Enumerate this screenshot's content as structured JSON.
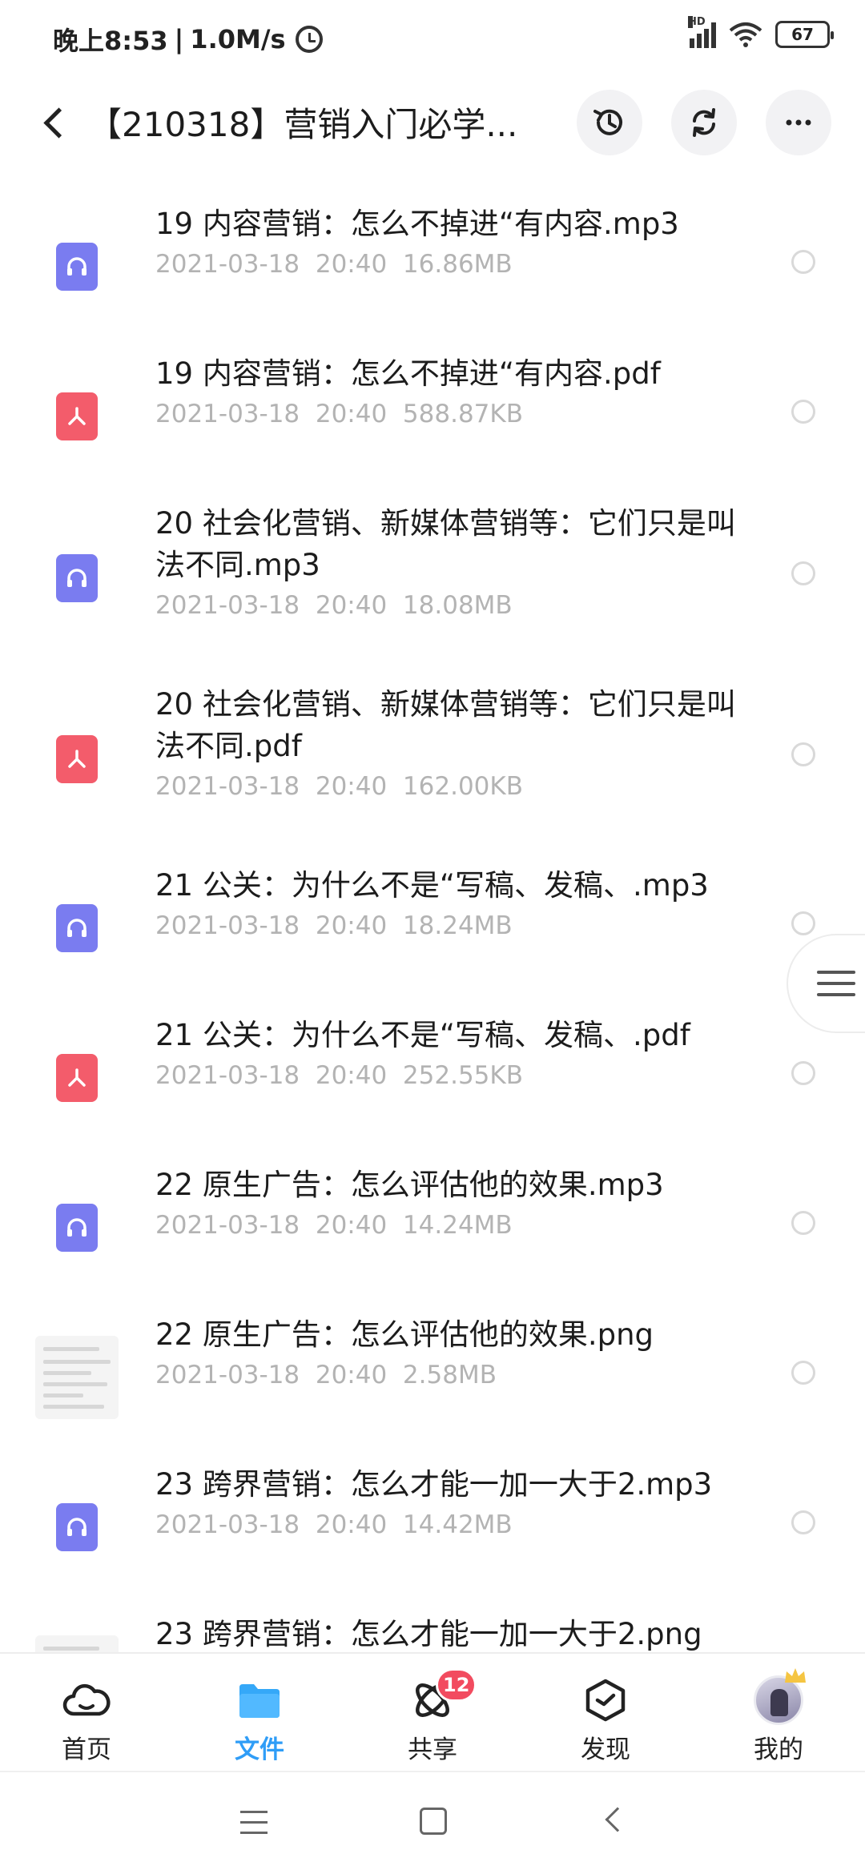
{
  "status": {
    "time": "晚上8:53",
    "separator": "|",
    "speed": "1.0M/s",
    "network_badge": "HD",
    "battery": "67"
  },
  "header": {
    "title": "【210318】营销入门必学..."
  },
  "files": [
    {
      "icon": "audio",
      "name": "19 内容营销：怎么不掉进“有内容.mp3",
      "date": "2021-03-18  20:40",
      "size": "16.86MB"
    },
    {
      "icon": "pdf",
      "name": "19 内容营销：怎么不掉进“有内容.pdf",
      "date": "2021-03-18  20:40",
      "size": "588.87KB"
    },
    {
      "icon": "audio",
      "name": "20 社会化营销、新媒体营销等：它们只是叫法不同.mp3",
      "date": "2021-03-18  20:40",
      "size": "18.08MB"
    },
    {
      "icon": "pdf",
      "name": "20 社会化营销、新媒体营销等：它们只是叫法不同.pdf",
      "date": "2021-03-18  20:40",
      "size": "162.00KB"
    },
    {
      "icon": "audio",
      "name": "21 公关：为什么不是“写稿、发稿、.mp3",
      "date": "2021-03-18  20:40",
      "size": "18.24MB"
    },
    {
      "icon": "pdf",
      "name": "21 公关：为什么不是“写稿、发稿、.pdf",
      "date": "2021-03-18  20:40",
      "size": "252.55KB"
    },
    {
      "icon": "audio",
      "name": "22 原生广告：怎么评估他的效果.mp3",
      "date": "2021-03-18  20:40",
      "size": "14.24MB"
    },
    {
      "icon": "image",
      "name": "22 原生广告：怎么评估他的效果.png",
      "date": "2021-03-18  20:40",
      "size": "2.58MB"
    },
    {
      "icon": "audio",
      "name": "23 跨界营销：怎么才能一加一大于2.mp3",
      "date": "2021-03-18  20:40",
      "size": "14.42MB"
    },
    {
      "icon": "image",
      "name": "23 跨界营销：怎么才能一加一大于2.png",
      "date": "",
      "size": ""
    }
  ],
  "nav": {
    "home": "首页",
    "files": "文件",
    "share": "共享",
    "share_badge": "12",
    "discover": "发现",
    "mine": "我的"
  },
  "colors": {
    "accent": "#2f9df7",
    "audio_icon": "#7a7cf0",
    "pdf_icon": "#f35c6b",
    "badge": "#f24b5f"
  }
}
